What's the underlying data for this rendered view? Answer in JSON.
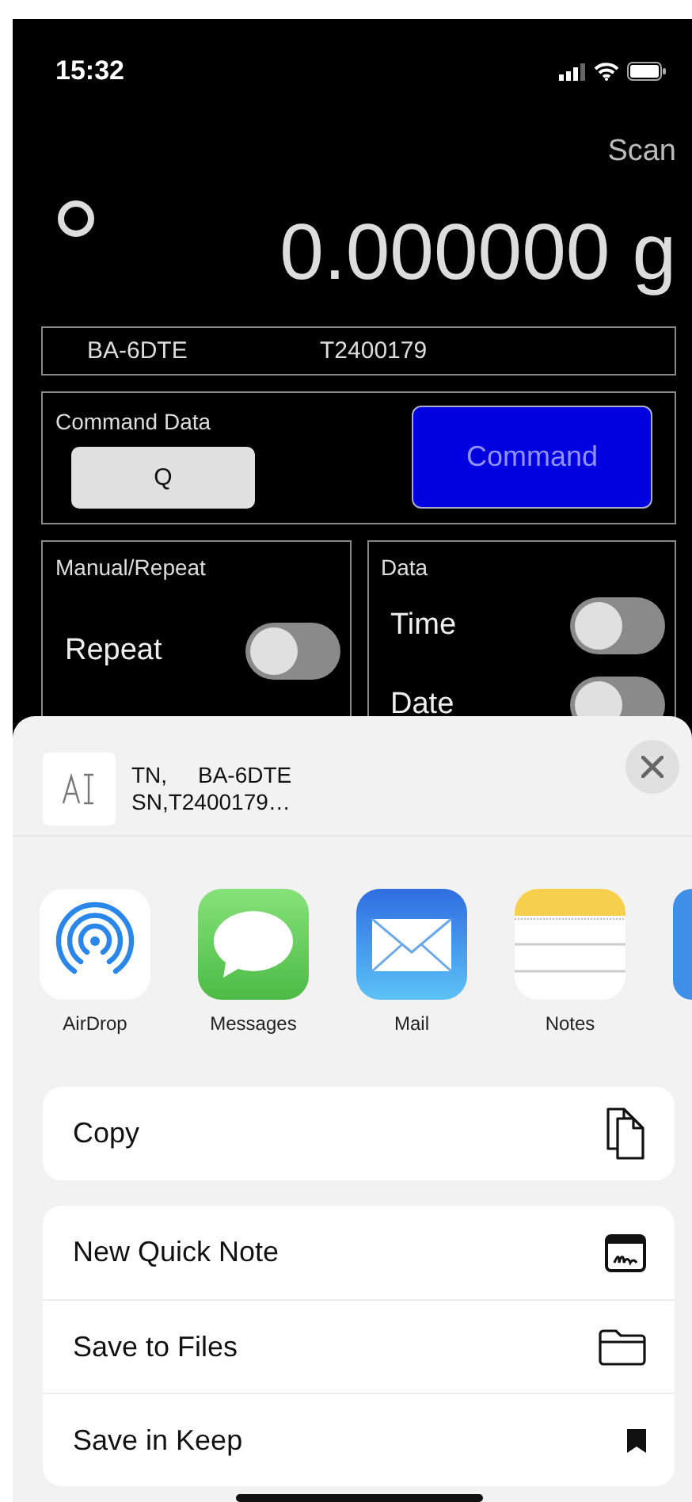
{
  "status_bar": {
    "time": "15:32"
  },
  "scan_button": "Scan",
  "reading": {
    "value": "0.000000",
    "unit": "g"
  },
  "device": {
    "model": "BA-6DTE",
    "serial": "T2400179"
  },
  "command": {
    "title": "Command Data",
    "value": "Q",
    "button": "Command"
  },
  "panels": [
    {
      "title": "Manual/Repeat",
      "toggles": [
        {
          "label": "Repeat",
          "on": false
        }
      ]
    },
    {
      "title": "Data",
      "toggles": [
        {
          "label": "Time",
          "on": false
        },
        {
          "label": "Date",
          "on": false
        }
      ]
    }
  ],
  "share_sheet": {
    "preview": {
      "lines": [
        "TN,     BA-6DTE",
        "SN,T2400179…"
      ]
    },
    "apps": [
      {
        "kind": "airdrop",
        "name": "AirDrop"
      },
      {
        "kind": "messages",
        "name": "Messages"
      },
      {
        "kind": "mail",
        "name": "Mail"
      },
      {
        "kind": "notes",
        "name": "Notes"
      },
      {
        "kind": "partial"
      }
    ],
    "action_groups": [
      [
        {
          "label": "Copy",
          "kind": "copy"
        }
      ],
      [
        {
          "label": "New Quick Note",
          "kind": "quick-note"
        },
        {
          "label": "Save to Files",
          "kind": "save-files"
        },
        {
          "label": "Save in Keep",
          "kind": "keep"
        }
      ]
    ]
  }
}
